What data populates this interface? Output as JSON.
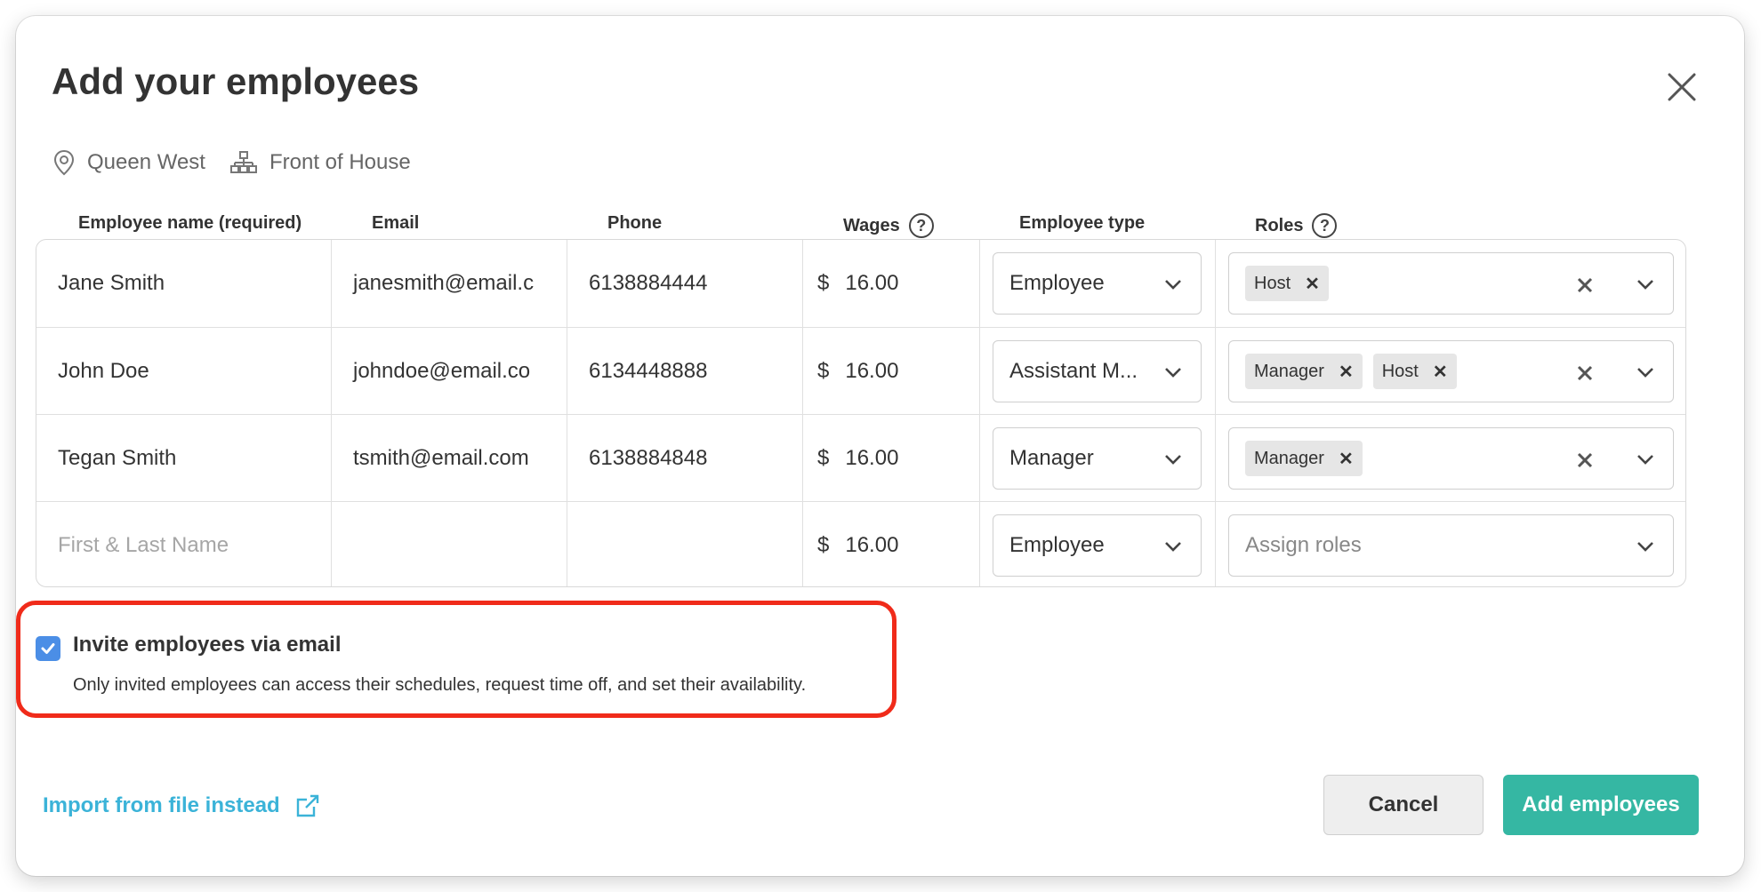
{
  "modal": {
    "title": "Add your employees",
    "location": "Queen West",
    "department": "Front of House"
  },
  "columns": {
    "name": "Employee name (required)",
    "email": "Email",
    "phone": "Phone",
    "wages": "Wages",
    "type": "Employee type",
    "roles": "Roles"
  },
  "rows": [
    {
      "name": "Jane Smith",
      "email": "janesmith@email.c",
      "phone": "6138884444",
      "currency": "$",
      "wage": "16.00",
      "type": "Employee",
      "roles": [
        "Host"
      ]
    },
    {
      "name": "John Doe",
      "email": "johndoe@email.co",
      "phone": "6134448888",
      "currency": "$",
      "wage": "16.00",
      "type": "Assistant M...",
      "roles": [
        "Manager",
        "Host"
      ]
    },
    {
      "name": "Tegan Smith",
      "email": "tsmith@email.com",
      "phone": "6138884848",
      "currency": "$",
      "wage": "16.00",
      "type": "Manager",
      "roles": [
        "Manager"
      ]
    }
  ],
  "new_row": {
    "name_placeholder": "First & Last Name",
    "currency": "$",
    "wage": "16.00",
    "type": "Employee",
    "roles_placeholder": "Assign roles"
  },
  "invite": {
    "checked": true,
    "label": "Invite employees via email",
    "description": "Only invited employees can access their schedules, request time off, and set their availability."
  },
  "footer": {
    "import_label": "Import from file instead",
    "cancel_label": "Cancel",
    "add_label": "Add employees"
  },
  "colors": {
    "accent": "#35b7a3",
    "link": "#3bb3d8",
    "checkbox": "#4b8ee6",
    "highlight": "#f02b1a"
  }
}
